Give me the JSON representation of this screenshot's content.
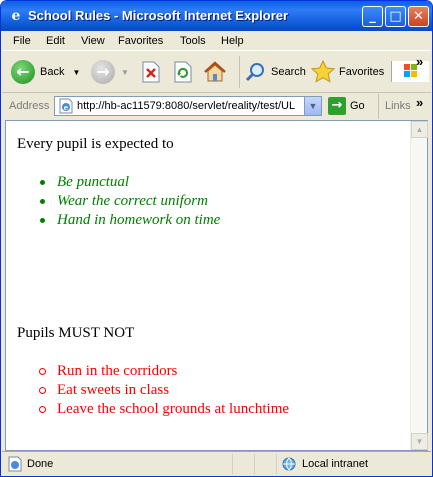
{
  "window": {
    "title": "School Rules - Microsoft Internet Explorer",
    "controls": {
      "minimize": "_",
      "maximize": "□",
      "close": "✕"
    }
  },
  "menu": [
    "File",
    "Edit",
    "View",
    "Favorites",
    "Tools",
    "Help"
  ],
  "toolbar": {
    "back_label": "Back",
    "search_label": "Search",
    "favorites_label": "Favorites",
    "overflow": "»"
  },
  "address": {
    "label": "Address",
    "url": "http://hb-ac11579:8080/servlet/reality/test/UL",
    "go_label": "Go",
    "links_label": "Links",
    "overflow": "»"
  },
  "page": {
    "intro": "Every pupil is expected to",
    "expected": [
      "Be punctual",
      "Wear the correct uniform",
      "Hand in homework on time"
    ],
    "must_not_heading": "Pupils MUST NOT",
    "forbidden": [
      "Run in the corridors",
      "Eat sweets in class",
      "Leave the school grounds at lunchtime"
    ],
    "expected_color": "#008000",
    "forbidden_color": "#ff0000"
  },
  "status": {
    "text": "Done",
    "zone": "Local intranet"
  }
}
